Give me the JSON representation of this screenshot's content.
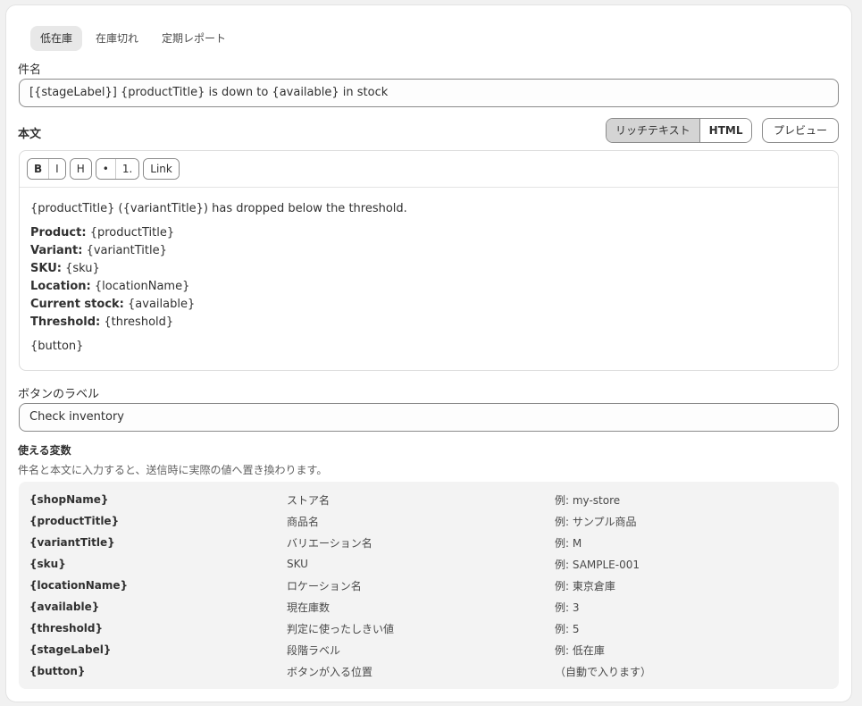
{
  "tabs": [
    {
      "label": "低在庫",
      "active": true
    },
    {
      "label": "在庫切れ",
      "active": false
    },
    {
      "label": "定期レポート",
      "active": false
    }
  ],
  "subject": {
    "label": "件名",
    "value": "[{stageLabel}] {productTitle} is down to {available} in stock"
  },
  "body": {
    "label": "本文",
    "mode_rich": "リッチテキスト",
    "mode_html": "HTML",
    "preview": "プレビュー",
    "toolbar": {
      "bold": "B",
      "italic": "I",
      "heading": "H",
      "bullet": "•",
      "ordered": "1.",
      "link": "Link"
    },
    "intro": "{productTitle} ({variantTitle}) has dropped below the threshold.",
    "fields": [
      {
        "key": "Product:",
        "value": "{productTitle}"
      },
      {
        "key": "Variant:",
        "value": "{variantTitle}"
      },
      {
        "key": "SKU:",
        "value": "{sku}"
      },
      {
        "key": "Location:",
        "value": "{locationName}"
      },
      {
        "key": "Current stock:",
        "value": "{available}"
      },
      {
        "key": "Threshold:",
        "value": "{threshold}"
      }
    ],
    "button_token": "{button}"
  },
  "button_label": {
    "label": "ボタンのラベル",
    "value": "Check inventory"
  },
  "variables": {
    "title": "使える変数",
    "hint": "件名と本文に入力すると、送信時に実際の値へ置き換わります。",
    "rows": [
      {
        "name": "{shopName}",
        "desc": "ストア名",
        "example": "例: my-store"
      },
      {
        "name": "{productTitle}",
        "desc": "商品名",
        "example": "例: サンプル商品"
      },
      {
        "name": "{variantTitle}",
        "desc": "バリエーション名",
        "example": "例: M"
      },
      {
        "name": "{sku}",
        "desc": "SKU",
        "example": "例: SAMPLE-001"
      },
      {
        "name": "{locationName}",
        "desc": "ロケーション名",
        "example": "例: 東京倉庫"
      },
      {
        "name": "{available}",
        "desc": "現在庫数",
        "example": "例: 3"
      },
      {
        "name": "{threshold}",
        "desc": "判定に使ったしきい値",
        "example": "例: 5"
      },
      {
        "name": "{stageLabel}",
        "desc": "段階ラベル",
        "example": "例: 低在庫"
      },
      {
        "name": "{button}",
        "desc": "ボタンが入る位置",
        "example": "（自動で入ります）"
      }
    ]
  }
}
